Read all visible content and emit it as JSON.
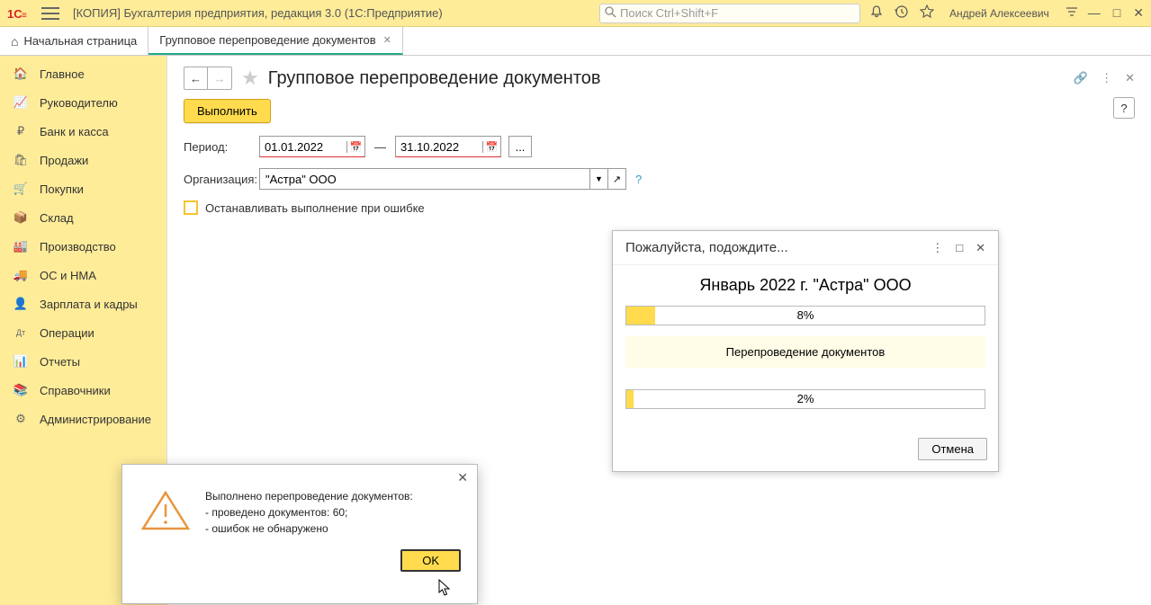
{
  "titlebar": {
    "logo_text": "1C",
    "app_title": "[КОПИЯ] Бухгалтерия предприятия, редакция 3.0  (1С:Предприятие)",
    "search_placeholder": "Поиск Ctrl+Shift+F",
    "user_name": "Андрей Алексеевич"
  },
  "tabs": {
    "home": "Начальная страница",
    "current": "Групповое перепроведение документов"
  },
  "sidebar": [
    {
      "icon": "🏠",
      "label": "Главное"
    },
    {
      "icon": "📈",
      "label": "Руководителю"
    },
    {
      "icon": "₽",
      "label": "Банк и касса"
    },
    {
      "icon": "🛍",
      "label": "Продажи"
    },
    {
      "icon": "🛒",
      "label": "Покупки"
    },
    {
      "icon": "📦",
      "label": "Склад"
    },
    {
      "icon": "🏭",
      "label": "Производство"
    },
    {
      "icon": "🚚",
      "label": "ОС и НМА"
    },
    {
      "icon": "👤",
      "label": "Зарплата и кадры"
    },
    {
      "icon": "Дт",
      "label": "Операции"
    },
    {
      "icon": "📊",
      "label": "Отчеты"
    },
    {
      "icon": "📚",
      "label": "Справочники"
    },
    {
      "icon": "⚙",
      "label": "Администрирование"
    }
  ],
  "page": {
    "title": "Групповое перепроведение документов",
    "execute_label": "Выполнить",
    "period_label": "Период:",
    "date_from": "01.01.2022",
    "date_to": "31.10.2022",
    "date_sep": "—",
    "org_label": "Организация:",
    "org_value": "\"Астра\" ООО",
    "checkbox_label": "Останавливать выполнение при ошибке",
    "help_q": "?",
    "dots": "..."
  },
  "progress": {
    "title": "Пожалуйста, подождите...",
    "heading": "Январь 2022 г. \"Астра\" ООО",
    "percent1": "8%",
    "fill1": 8,
    "status": "Перепроведение документов",
    "percent2": "2%",
    "fill2": 2,
    "cancel_label": "Отмена"
  },
  "message": {
    "line1": "Выполнено перепроведение документов:",
    "line2": "- проведено документов: 60;",
    "line3": "- ошибок не обнаружено",
    "ok_label": "OK"
  }
}
